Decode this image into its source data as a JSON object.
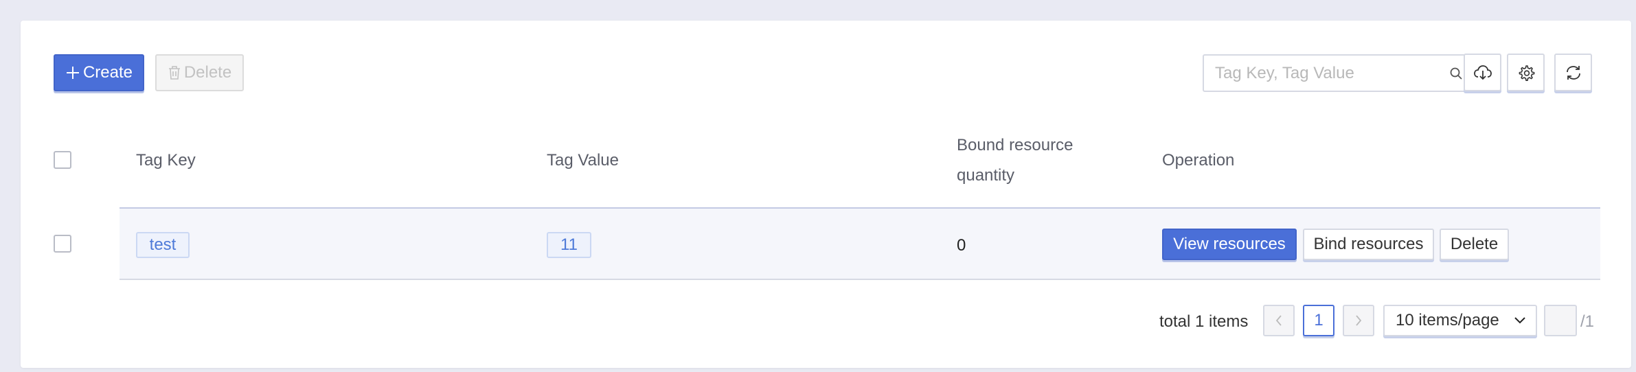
{
  "toolbar": {
    "create_label": "Create",
    "delete_label": "Delete",
    "search_placeholder": "Tag Key, Tag Value"
  },
  "table": {
    "columns": {
      "tag_key": "Tag Key",
      "tag_value": "Tag Value",
      "bound_line1": "Bound resource",
      "bound_line2": "quantity",
      "operation": "Operation"
    },
    "rows": [
      {
        "tag_key": "test",
        "tag_value": "11",
        "bound_quantity": "0",
        "actions": {
          "view": "View resources",
          "bind": "Bind resources",
          "delete": "Delete"
        }
      }
    ]
  },
  "pagination": {
    "total_text": "total 1 items",
    "current_page": "1",
    "page_size": "10 items/page",
    "jump_value": "",
    "total_pages": "/1"
  },
  "colors": {
    "primary": "#4a6fd8",
    "background": "#e9eaf3",
    "tag_text": "#4e7ad8"
  }
}
